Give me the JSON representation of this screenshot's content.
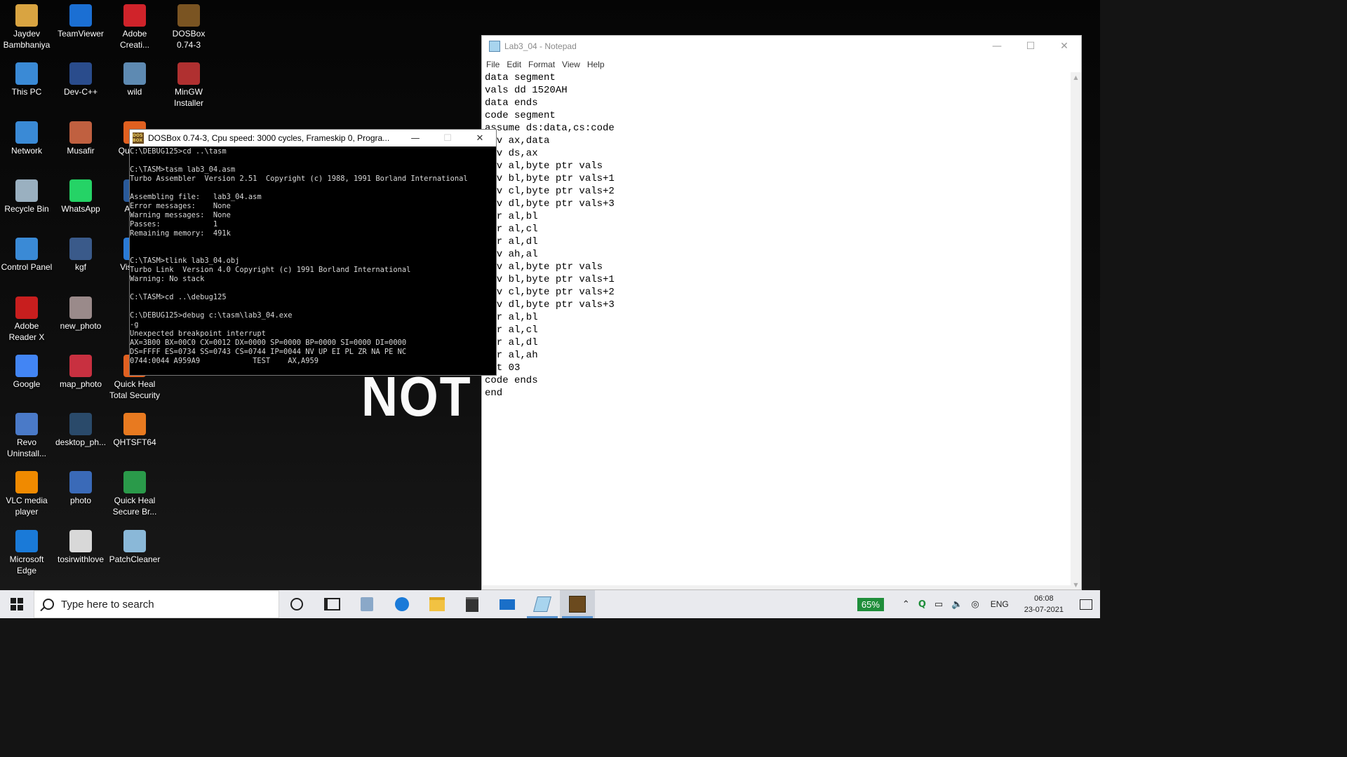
{
  "desktop": {
    "wallpaper_text": "NOT",
    "icons": [
      {
        "label": "Jaydev Bambhaniya",
        "icon": "user-folder-icon",
        "color": "#d9a441"
      },
      {
        "label": "TeamViewer",
        "icon": "teamviewer-icon",
        "color": "#1b6fd3"
      },
      {
        "label": "Adobe Creati...",
        "icon": "adobe-creative-cloud-icon",
        "color": "#d0232a"
      },
      {
        "label": "DOSBox 0.74-3",
        "icon": "dosbox-icon",
        "color": "#7a5422"
      },
      {
        "label": "This PC",
        "icon": "computer-icon",
        "color": "#3a8ad6"
      },
      {
        "label": "Dev-C++",
        "icon": "devcpp-icon",
        "color": "#2a4c8c"
      },
      {
        "label": "wild",
        "icon": "image-file-icon",
        "color": "#5e8ab2"
      },
      {
        "label": "MinGW Installer",
        "icon": "installer-icon",
        "color": "#b03030"
      },
      {
        "label": "Network",
        "icon": "network-icon",
        "color": "#3a8ad6"
      },
      {
        "label": "Musafir",
        "icon": "image-file-icon",
        "color": "#c06040"
      },
      {
        "label": "Qui Safe",
        "icon": "quick-heal-icon",
        "color": "#e06020"
      },
      {
        "label": "Recycle Bin",
        "icon": "recycle-bin-icon",
        "color": "#9ab0c0"
      },
      {
        "label": "WhatsApp",
        "icon": "whatsapp-icon",
        "color": "#25d366"
      },
      {
        "label": "A Net",
        "icon": "app-icon",
        "color": "#2a5a9a"
      },
      {
        "label": "Control Panel",
        "icon": "control-panel-icon",
        "color": "#3a8ad6"
      },
      {
        "label": "kgf",
        "icon": "image-file-icon",
        "color": "#3a5a8a"
      },
      {
        "label": "Visua C",
        "icon": "visual-studio-icon",
        "color": "#2a7ad6"
      },
      {
        "label": "Adobe Reader X",
        "icon": "adobe-reader-icon",
        "color": "#c81e1e"
      },
      {
        "label": "new_photo",
        "icon": "image-file-icon",
        "color": "#9a8a8a"
      },
      {
        "label": "Google",
        "icon": "chrome-icon",
        "color": "#4285f4"
      },
      {
        "label": "map_photo",
        "icon": "image-file-icon",
        "color": "#c83040"
      },
      {
        "label": "Quick Heal Total Security",
        "icon": "quick-heal-icon",
        "color": "#e06020"
      },
      {
        "label": "Revo Uninstall...",
        "icon": "revo-uninstaller-icon",
        "color": "#4a7ac8"
      },
      {
        "label": "desktop_ph...",
        "icon": "image-file-icon",
        "color": "#2a4a6a"
      },
      {
        "label": "QHTSFT64",
        "icon": "quick-heal-icon",
        "color": "#e87a20"
      },
      {
        "label": "VLC media player",
        "icon": "vlc-icon",
        "color": "#f08a00"
      },
      {
        "label": "photo",
        "icon": "image-file-icon",
        "color": "#3a6ab8"
      },
      {
        "label": "Quick Heal Secure Br...",
        "icon": "secure-browser-icon",
        "color": "#2a9a4a"
      },
      {
        "label": "Microsoft Edge",
        "icon": "edge-icon",
        "color": "#1a7ad8"
      },
      {
        "label": "tosirwithlove",
        "icon": "document-icon",
        "color": "#d8d8d8"
      },
      {
        "label": "PatchCleaner",
        "icon": "patchcleaner-icon",
        "color": "#8ab8d8"
      }
    ]
  },
  "notepad": {
    "title": "Lab3_04 - Notepad",
    "menu": [
      "File",
      "Edit",
      "Format",
      "View",
      "Help"
    ],
    "controls": {
      "minimize": "—",
      "maximize": "☐",
      "close": "✕"
    },
    "content": "data segment\nvals dd 1520AH\ndata ends\ncode segment\nassume ds:data,cs:code\nmov ax,data\nmov ds,ax\nmov al,byte ptr vals\nmov bl,byte ptr vals+1\nmov cl,byte ptr vals+2\nmov dl,byte ptr vals+3\nxor al,bl\nxor al,cl\nxor al,dl\nmov ah,al\nmov al,byte ptr vals\nmov bl,byte ptr vals+1\nmov cl,byte ptr vals+2\nmov dl,byte ptr vals+3\nxor al,bl\nxor al,cl\nxor al,dl\nxor al,ah\nint 03\ncode ends\nend"
  },
  "dosbox": {
    "title": "DOSBox 0.74-3, Cpu speed:     3000 cycles, Frameskip  0, Progra...",
    "icon_text": "DOS BOX",
    "controls": {
      "minimize": "—",
      "maximize": "☐",
      "close": "✕"
    },
    "screen": "C:\\DEBUG125>cd ..\\tasm\n\nC:\\TASM>tasm lab3_04.asm\nTurbo Assembler  Version 2.51  Copyright (c) 1988, 1991 Borland International\n\nAssembling file:   lab3_04.asm\nError messages:    None\nWarning messages:  None\nPasses:            1\nRemaining memory:  491k\n\n\nC:\\TASM>tlink lab3_04.obj\nTurbo Link  Version 4.0 Copyright (c) 1991 Borland International\nWarning: No stack\n\nC:\\TASM>cd ..\\debug125\n\nC:\\DEBUG125>debug c:\\tasm\\lab3_04.exe\n-g\nUnexpected breakpoint interrupt\nAX=3B00 BX=00C0 CX=0012 DX=0000 SP=0000 BP=0000 SI=0000 DI=0000\nDS=FFFF ES=0734 SS=0743 CS=0744 IP=0044 NV UP EI PL ZR NA PE NC\n0744:0044 A959A9            TEST    AX,A959"
  },
  "taskbar": {
    "search_placeholder": "Type here to search",
    "battery_percent": "65%",
    "language": "ENG",
    "time": "06:08",
    "date": "23-07-2021",
    "accent": "#5a94d0"
  }
}
